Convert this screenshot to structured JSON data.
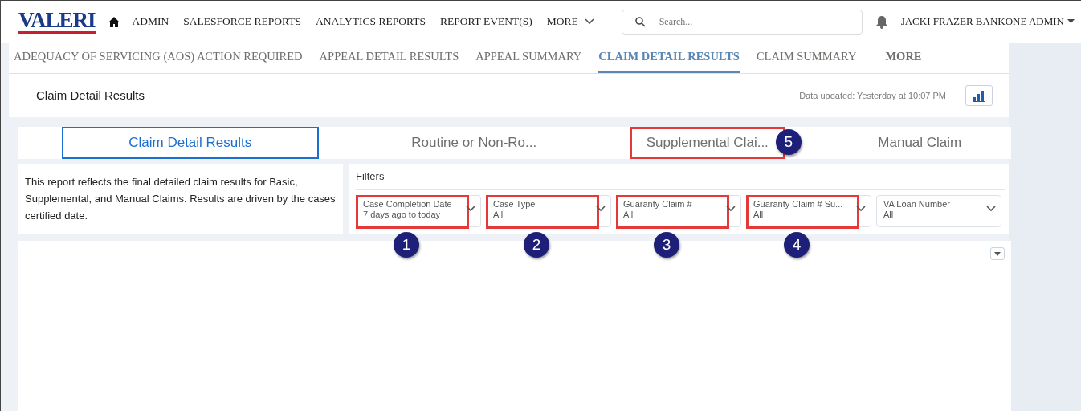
{
  "app": {
    "logo": "VALERI"
  },
  "nav": [
    {
      "label": "ADMIN",
      "selected": false
    },
    {
      "label": "SALESFORCE REPORTS",
      "selected": false
    },
    {
      "label": "ANALYTICS REPORTS",
      "selected": true
    },
    {
      "label": "REPORT EVENT(S)",
      "selected": false
    },
    {
      "label": "MORE",
      "selected": false,
      "kind": "menu"
    }
  ],
  "search": {
    "placeholder": "Search..."
  },
  "user": {
    "name": "JACKI FRAZER BANKONE ADMIN"
  },
  "report_tabs": [
    {
      "label": "ADEQUACY OF SERVICING (AOS) ACTION REQUIRED",
      "selected": false
    },
    {
      "label": "APPEAL DETAIL RESULTS",
      "selected": false
    },
    {
      "label": "APPEAL SUMMARY",
      "selected": false
    },
    {
      "label": "CLAIM DETAIL RESULTS",
      "selected": true
    },
    {
      "label": "CLAIM SUMMARY",
      "selected": false
    },
    {
      "label": "MORE",
      "selected": false,
      "kind": "more"
    }
  ],
  "header": {
    "title": "Claim Detail Results",
    "updated": "Data updated: Yesterday at 10:07 PM"
  },
  "dashboard_tabs": [
    {
      "label": "Claim Detail Results",
      "selected": true
    },
    {
      "label": "Routine or Non-Ro...",
      "selected": false
    },
    {
      "label": "Supplemental Clai...",
      "selected": false,
      "callout": "5"
    },
    {
      "label": "Manual Claim",
      "selected": false
    }
  ],
  "description": "This report reflects the final detailed claim results for Basic, Supplemental, and Manual Claims.  Results are driven by the cases certified date.",
  "filters": {
    "title": "Filters",
    "items": [
      {
        "label": "Case Completion Date",
        "value": "7 days ago to today",
        "callout": "1"
      },
      {
        "label": "Case Type",
        "value": "All",
        "callout": "2"
      },
      {
        "label": "Guaranty Claim #",
        "value": "All",
        "callout": "3"
      },
      {
        "label": "Guaranty Claim # Su...",
        "value": "All",
        "callout": "4"
      },
      {
        "label": "VA Loan Number",
        "value": "All"
      }
    ]
  }
}
